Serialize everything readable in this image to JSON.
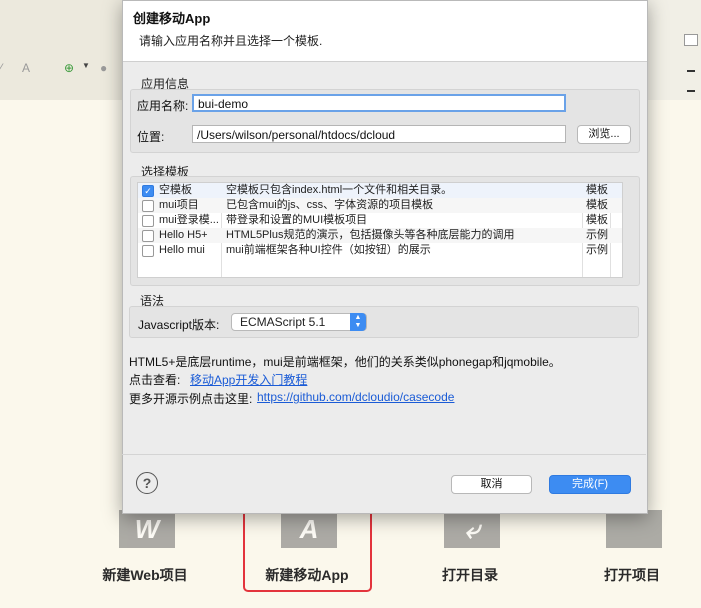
{
  "dialog": {
    "title": "创建移动App",
    "subtitle": "请输入应用名称并且选择一个模板.",
    "app_info": {
      "group_label": "应用信息",
      "name_label": "应用名称:",
      "name_value": "bui-demo",
      "location_label": "位置:",
      "location_value": "/Users/wilson/personal/htdocs/dcloud",
      "browse_label": "浏览..."
    },
    "templates": {
      "group_label": "选择模板",
      "rows": [
        {
          "checked": true,
          "name": "空模板",
          "desc": "空模板只包含index.html一个文件和相关目录。",
          "type": "模板"
        },
        {
          "checked": false,
          "name": "mui项目",
          "desc": "已包含mui的js、css、字体资源的项目模板",
          "type": "模板"
        },
        {
          "checked": false,
          "name": "mui登录模...",
          "desc": "带登录和设置的MUI模板项目",
          "type": "模板"
        },
        {
          "checked": false,
          "name": "Hello H5+",
          "desc": "HTML5Plus规范的演示，包括摄像头等各种底层能力的调用",
          "type": "示例"
        },
        {
          "checked": false,
          "name": "Hello mui",
          "desc": "mui前端框架各种UI控件（如按钮）的展示",
          "type": "示例"
        }
      ]
    },
    "syntax": {
      "group_label": "语法",
      "js_label": "Javascript版本:",
      "js_value": "ECMAScript 5.1"
    },
    "info": {
      "line1": "HTML5+是底层runtime，mui是前端框架，他们的关系类似phonegap和jqmobile。",
      "line2_label": "点击查看:",
      "line2_link": "移动App开发入门教程",
      "line3_label": "更多开源示例点击这里:",
      "line3_link": "https://github.com/dcloudio/casecode"
    },
    "footer": {
      "help_icon_text": "?",
      "cancel_label": "取消",
      "finish_label": "完成(F)"
    }
  },
  "launcher": {
    "items": [
      {
        "label": "新建Web项目",
        "icon": "web-project-icon",
        "glyph": "W"
      },
      {
        "label": "新建移动App",
        "icon": "mobile-app-icon",
        "glyph": "A"
      },
      {
        "label": "打开目录",
        "icon": "open-folder-icon",
        "glyph": "⤶"
      },
      {
        "label": "打开项目",
        "icon": "open-project-icon",
        "glyph": ""
      }
    ]
  },
  "colors": {
    "accent": "#3d8cf2",
    "highlight_border": "#e3343c",
    "link": "#1a5bd6"
  }
}
